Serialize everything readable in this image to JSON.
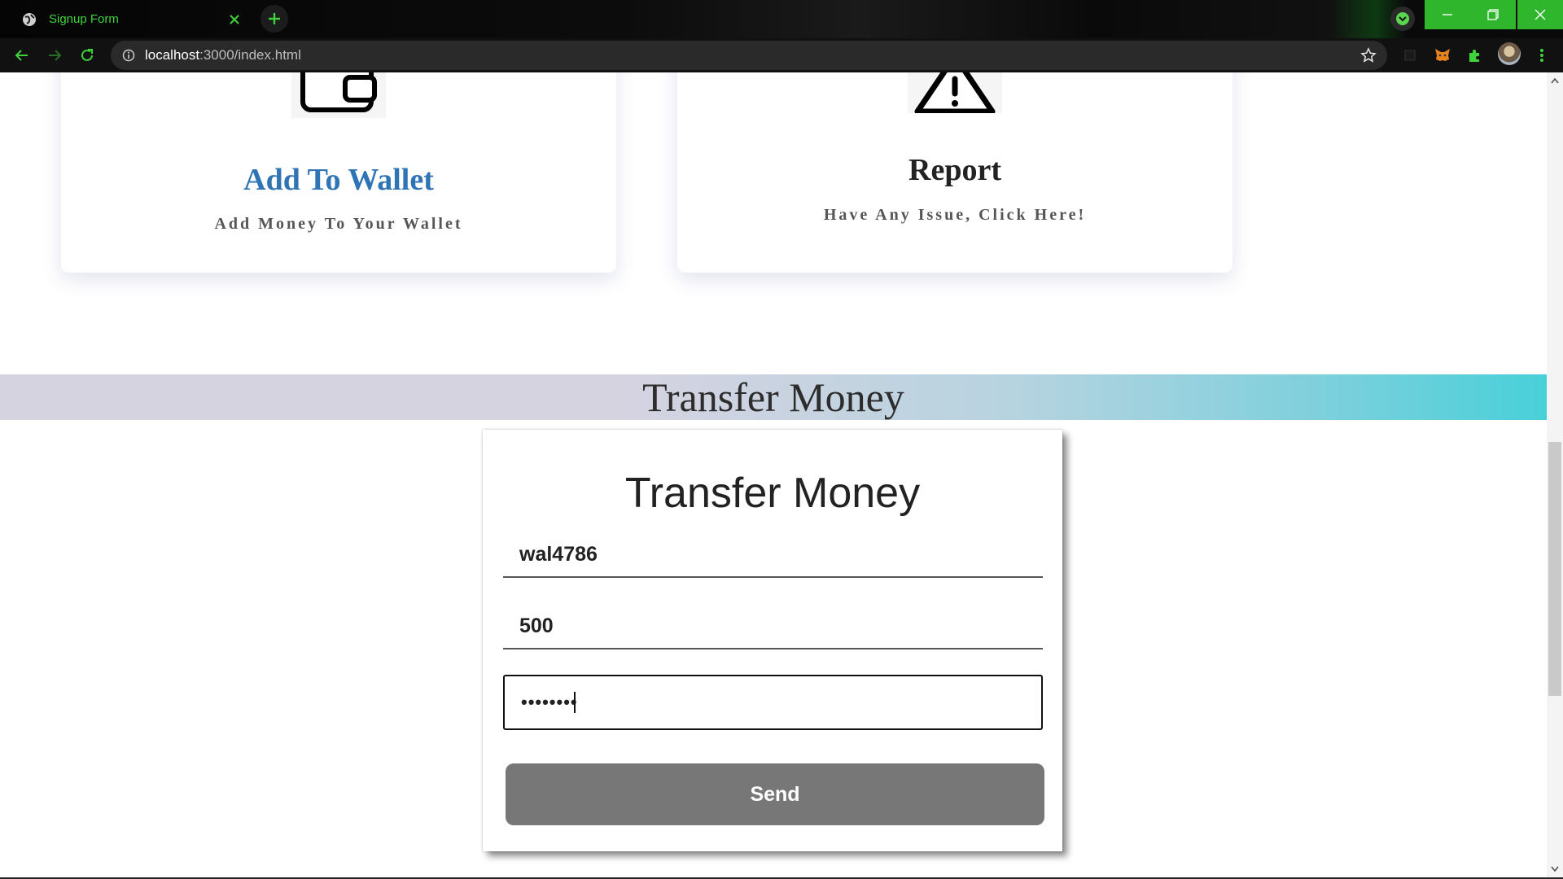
{
  "browser": {
    "tab_title": "Signup Form",
    "url_host": "localhost",
    "url_rest": ":3000/index.html"
  },
  "cards": [
    {
      "title": "Add To Wallet",
      "subtitle": "Add Money To Your Wallet",
      "title_color": "#2f74b5",
      "icon": "wallet-icon"
    },
    {
      "title": "Report",
      "subtitle": "Have Any Issue, Click Here!",
      "title_color": "#222222",
      "icon": "warning-icon"
    }
  ],
  "banner": {
    "title": "Transfer Money"
  },
  "form": {
    "title": "Transfer Money",
    "user_value": "wal4786",
    "amount_value": "500",
    "password_value": "••••••••",
    "send_label": "Send"
  },
  "colors": {
    "accent": "#2fb62c",
    "button": "#777777"
  }
}
